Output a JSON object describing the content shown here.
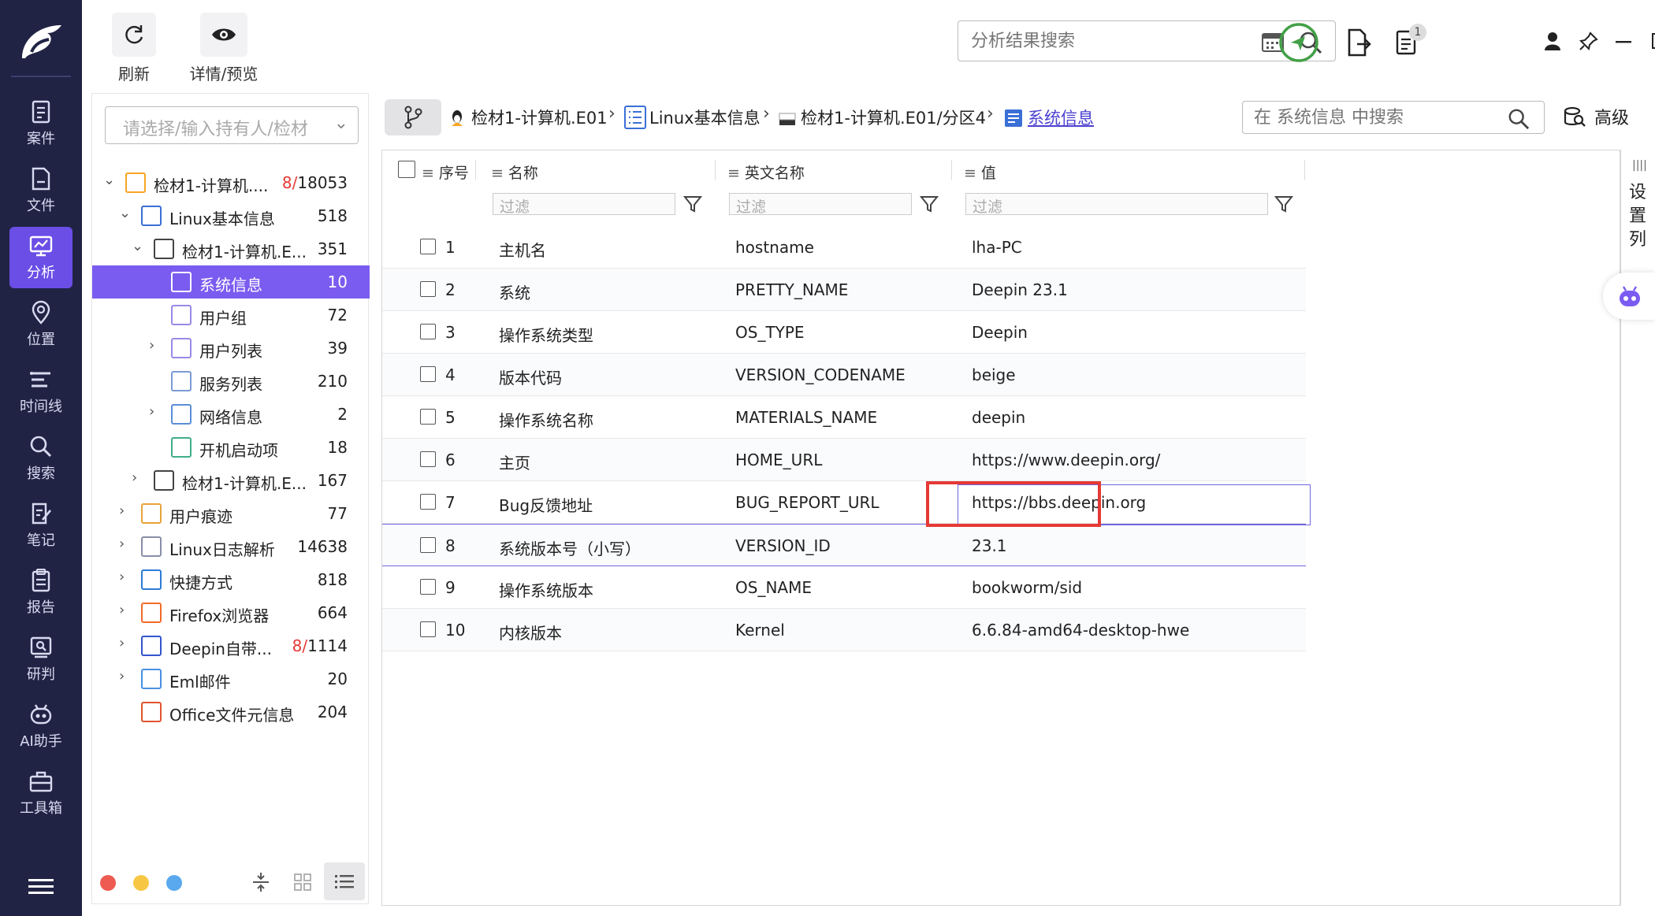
{
  "nav": {
    "items": [
      {
        "label": "案件",
        "icon": "case-icon"
      },
      {
        "label": "文件",
        "icon": "file-icon"
      },
      {
        "label": "分析",
        "icon": "analysis-icon"
      },
      {
        "label": "位置",
        "icon": "location-icon"
      },
      {
        "label": "时间线",
        "icon": "timeline-icon"
      },
      {
        "label": "搜索",
        "icon": "search-icon"
      },
      {
        "label": "笔记",
        "icon": "note-icon"
      },
      {
        "label": "报告",
        "icon": "report-icon"
      },
      {
        "label": "研判",
        "icon": "judge-icon"
      },
      {
        "label": "AI助手",
        "icon": "robot-icon"
      },
      {
        "label": "工具箱",
        "icon": "toolbox-icon"
      }
    ],
    "active": "分析"
  },
  "toolbar": {
    "refresh_label": "刷新",
    "preview_label": "详情/预览",
    "search_placeholder": "分析结果搜索",
    "task_badge": "1"
  },
  "tree": {
    "owner_placeholder": "请选择/输入持有人/检材",
    "rows": [
      {
        "label": "检材1-计算机....",
        "count": "18053",
        "count_prefix": "8/",
        "icon": "linux-icon"
      },
      {
        "label": "Linux基本信息",
        "count": "518",
        "icon": "list-icon"
      },
      {
        "label": "检材1-计算机.E...",
        "count": "351",
        "icon": "disk-icon"
      },
      {
        "label": "系统信息",
        "count": "10",
        "icon": "sysinfo-icon"
      },
      {
        "label": "用户组",
        "count": "72",
        "icon": "user-group-icon"
      },
      {
        "label": "用户列表",
        "count": "39",
        "icon": "user-icon"
      },
      {
        "label": "服务列表",
        "count": "210",
        "icon": "service-icon"
      },
      {
        "label": "网络信息",
        "count": "2",
        "icon": "network-icon"
      },
      {
        "label": "开机启动项",
        "count": "18",
        "icon": "startup-icon"
      },
      {
        "label": "检材1-计算机.E...",
        "count": "167",
        "icon": "disk-icon"
      },
      {
        "label": "用户痕迹",
        "count": "77",
        "icon": "trace-icon"
      },
      {
        "label": "Linux日志解析",
        "count": "14638",
        "icon": "log-icon"
      },
      {
        "label": "快捷方式",
        "count": "818",
        "icon": "shortcut-icon"
      },
      {
        "label": "Firefox浏览器",
        "count": "664",
        "icon": "firefox-icon"
      },
      {
        "label": "Deepin自带...",
        "count": "1114",
        "count_prefix": "8/",
        "icon": "deepin-icon"
      },
      {
        "label": "Eml邮件",
        "count": "20",
        "icon": "mail-icon"
      },
      {
        "label": "Office文件元信息",
        "count": "204",
        "icon": "office-icon"
      }
    ]
  },
  "breadcrumb": {
    "items": [
      "检材1-计算机.E01",
      "Linux基本信息",
      "检材1-计算机.E01/分区4",
      "系统信息"
    ],
    "search_placeholder": "在 系统信息 中搜索",
    "advanced_label": "高级"
  },
  "grid": {
    "headers": {
      "index": "序号",
      "name": "名称",
      "en_name": "英文名称",
      "value": "值"
    },
    "filter_placeholder": "过滤",
    "rows": [
      {
        "index": "1",
        "name": "主机名",
        "en_name": "hostname",
        "value": "lha-PC"
      },
      {
        "index": "2",
        "name": "系统",
        "en_name": "PRETTY_NAME",
        "value": "Deepin 23.1"
      },
      {
        "index": "3",
        "name": "操作系统类型",
        "en_name": "OS_TYPE",
        "value": "Deepin"
      },
      {
        "index": "4",
        "name": "版本代码",
        "en_name": "VERSION_CODENAME",
        "value": "beige"
      },
      {
        "index": "5",
        "name": "操作系统名称",
        "en_name": "MATERIALS_NAME",
        "value": "deepin"
      },
      {
        "index": "6",
        "name": "主页",
        "en_name": "HOME_URL",
        "value": "https://www.deepin.org/"
      },
      {
        "index": "7",
        "name": "Bug反馈地址",
        "en_name": "BUG_REPORT_URL",
        "value": "https://bbs.deepin.org"
      },
      {
        "index": "8",
        "name": "系统版本号（小写）",
        "en_name": "VERSION_ID",
        "value": "23.1"
      },
      {
        "index": "9",
        "name": "操作系统版本",
        "en_name": "OS_NAME",
        "value": "bookworm/sid"
      },
      {
        "index": "10",
        "name": "内核版本",
        "en_name": "Kernel",
        "value": "6.6.84-amd64-desktop-hwe"
      }
    ],
    "settings_label": "设置列"
  },
  "colors": {
    "nav_bg": "#202344",
    "accent": "#6a4ee6",
    "highlight": "#e53935"
  }
}
